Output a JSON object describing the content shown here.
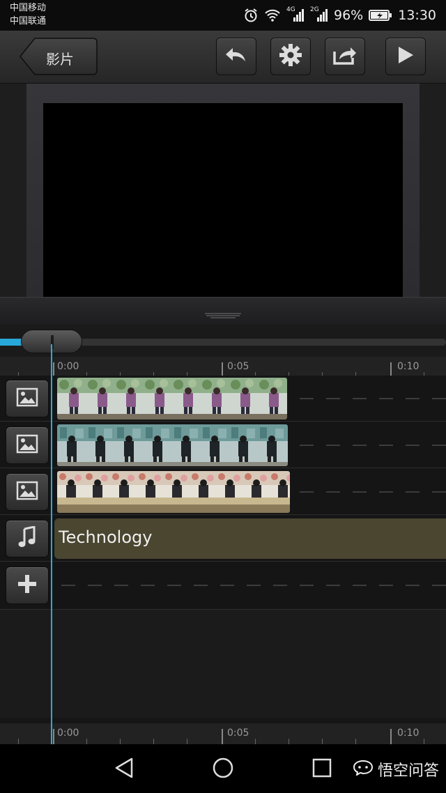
{
  "status_bar": {
    "carrier_1": "中国移动",
    "carrier_2": "中国联通",
    "network_1": "4G",
    "network_2": "2G",
    "battery": "96%",
    "time": "13:30"
  },
  "toolbar": {
    "back_label": "影片",
    "icons": [
      "undo-icon",
      "gear-icon",
      "share-icon",
      "play-icon"
    ]
  },
  "ruler": {
    "labels": [
      "0:00",
      "0:05",
      "0:10"
    ]
  },
  "tracks": [
    {
      "type": "image",
      "icon": "image-icon"
    },
    {
      "type": "image",
      "icon": "image-icon"
    },
    {
      "type": "image",
      "icon": "image-icon"
    },
    {
      "type": "audio",
      "icon": "music-note-icon",
      "label": "Technology"
    },
    {
      "type": "add",
      "icon": "plus-icon"
    }
  ],
  "navbar": {
    "icons": [
      "back-triangle-icon",
      "home-circle-icon",
      "recents-square-icon"
    ],
    "watermark": "悟空问答"
  },
  "colors": {
    "accent": "#28a7d9",
    "audio_clip": "#4a4630"
  }
}
